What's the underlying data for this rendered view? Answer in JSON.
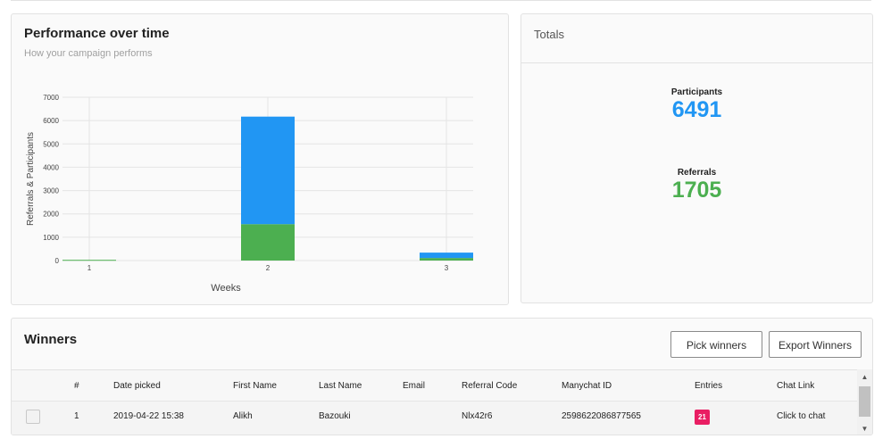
{
  "performance": {
    "title": "Performance over time",
    "subtitle": "How your campaign performs"
  },
  "chart_data": {
    "type": "bar",
    "stacked": true,
    "categories": [
      "1",
      "2",
      "3"
    ],
    "series": [
      {
        "color": "#4caf50",
        "values": [
          30,
          1560,
          110
        ]
      },
      {
        "color": "#2196f3",
        "values": [
          0,
          4610,
          230
        ]
      }
    ],
    "xlabel": "Weeks",
    "ylabel": "Referrals & Participants",
    "ylim": [
      0,
      7000
    ],
    "yticks": [
      "0",
      "1000",
      "2000",
      "3000",
      "4000",
      "5000",
      "6000",
      "7000"
    ],
    "grid": true
  },
  "totals": {
    "title": "Totals",
    "participants_label": "Participants",
    "participants_value": "6491",
    "referrals_label": "Referrals",
    "referrals_value": "1705",
    "participants_color": "#2196f3",
    "referrals_color": "#4caf50"
  },
  "winners": {
    "title": "Winners",
    "pick_label": "Pick winners",
    "export_label": "Export Winners",
    "columns": [
      "#",
      "Date picked",
      "First Name",
      "Last Name",
      "Email",
      "Referral Code",
      "Manychat ID",
      "Entries",
      "Chat Link"
    ],
    "rows": [
      {
        "num": "1",
        "date": "2019-04-22 15:38",
        "first": "Alikh",
        "last": "Bazouki",
        "email": "",
        "code": "Nlx42r6",
        "manychat": "2598622086877565",
        "entries": "21",
        "chat": "Click to chat"
      }
    ],
    "badge_color": "#e91e63"
  },
  "icons": {
    "scroll_up": "▲",
    "scroll_down": "▼"
  }
}
